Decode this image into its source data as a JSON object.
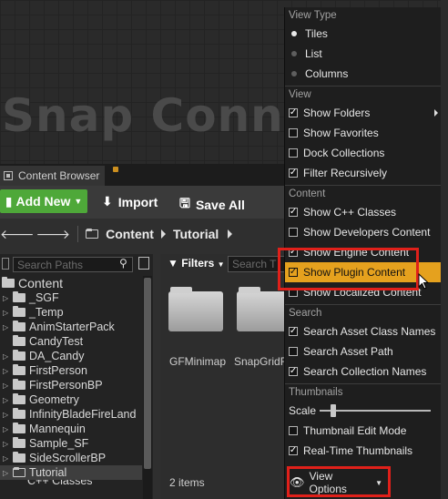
{
  "viewport": {
    "watermark": "Snap Connec"
  },
  "content_browser": {
    "tab_label": "Content Browser",
    "toolbar": {
      "add_new": "Add New",
      "import": "Import",
      "save_all": "Save All"
    },
    "path": [
      "Content",
      "Tutorial"
    ],
    "search_paths_placeholder": "Search Paths",
    "tree_root": "Content",
    "tree_items": [
      "_SGF",
      "_Temp",
      "AnimStarterPack",
      "CandyTest",
      "DA_Candy",
      "FirstPerson",
      "FirstPersonBP",
      "Geometry",
      "InfinityBladeFireLand",
      "Mannequin",
      "Sample_SF",
      "SideScrollerBP",
      "Tutorial"
    ],
    "tree_partial": "C++ Classes",
    "filters_label": "Filters",
    "search_assets_placeholder": "Search T",
    "assets": [
      "GFMinimap",
      "SnapGridF"
    ],
    "items_count": "2 items"
  },
  "menu": {
    "view_type_header": "View Type",
    "view_types": [
      {
        "label": "Tiles",
        "selected": true
      },
      {
        "label": "List",
        "selected": false
      },
      {
        "label": "Columns",
        "selected": false
      }
    ],
    "view_header": "View",
    "view_items": [
      {
        "label": "Show Folders",
        "checked": true
      },
      {
        "label": "Show Favorites",
        "checked": false
      },
      {
        "label": "Dock Collections",
        "checked": false
      },
      {
        "label": "Filter Recursively",
        "checked": true
      }
    ],
    "content_header": "Content",
    "content_items": [
      {
        "label": "Show C++ Classes",
        "checked": true
      },
      {
        "label": "Show Developers Content",
        "checked": false
      },
      {
        "label": "Show Engine Content",
        "checked": true
      },
      {
        "label": "Show Plugin Content",
        "checked": true
      },
      {
        "label": "Show Localized Content",
        "checked": false
      }
    ],
    "search_header": "Search",
    "search_items": [
      {
        "label": "Search Asset Class Names",
        "checked": true
      },
      {
        "label": "Search Asset Path",
        "checked": false
      },
      {
        "label": "Search Collection Names",
        "checked": true
      }
    ],
    "thumbnails_header": "Thumbnails",
    "scale_label": "Scale",
    "scale_value": 0.12,
    "thumb_items": [
      {
        "label": "Thumbnail Edit Mode",
        "checked": false
      },
      {
        "label": "Real-Time Thumbnails",
        "checked": true
      }
    ],
    "view_options": "View Options"
  },
  "colors": {
    "highlight": "#e5a11e",
    "annotation_red": "#e0201a",
    "add_new_green": "#4ea839"
  }
}
